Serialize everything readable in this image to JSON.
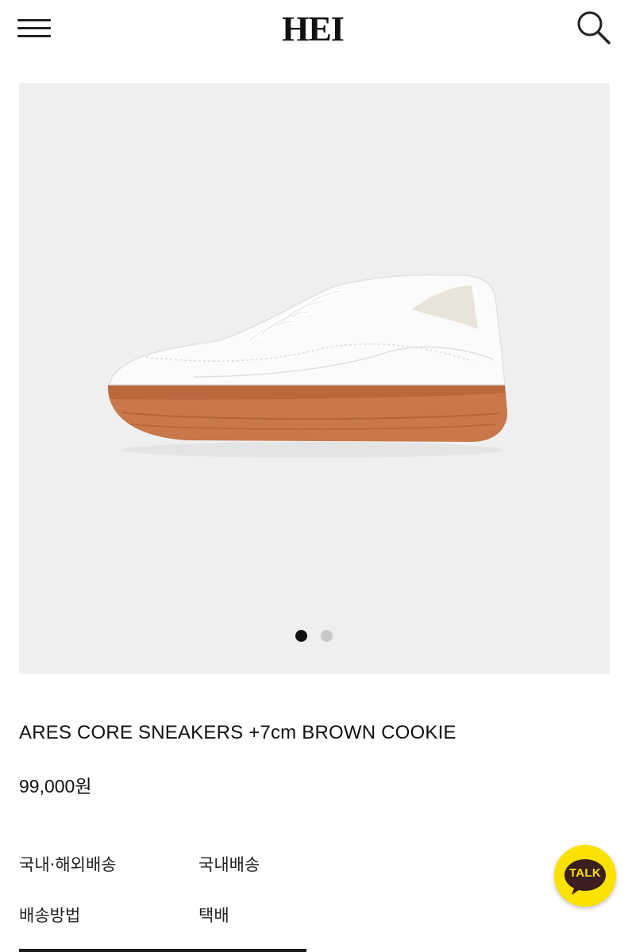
{
  "header": {
    "brand": "HEI",
    "menu_icon": "hamburger-menu-icon",
    "search_icon": "search-icon"
  },
  "gallery": {
    "image_subject": "white sneaker with brown gum sole",
    "slide_count": 2,
    "active_slide": 1
  },
  "product": {
    "title": "ARES CORE SNEAKERS +7cm BROWN COOKIE",
    "price": "99,000원"
  },
  "shipping_info": [
    {
      "label": "국내·해외배송",
      "value": "국내배송"
    },
    {
      "label": "배송방법",
      "value": "택배"
    }
  ],
  "chat": {
    "label": "TALK",
    "icon": "kakaotalk-chat-icon",
    "color": "#fae100"
  },
  "colors": {
    "gallery_bg": "#efefef",
    "active_dot": "#111111",
    "inactive_dot": "#c8c8c8",
    "sole": "#c8784a"
  }
}
